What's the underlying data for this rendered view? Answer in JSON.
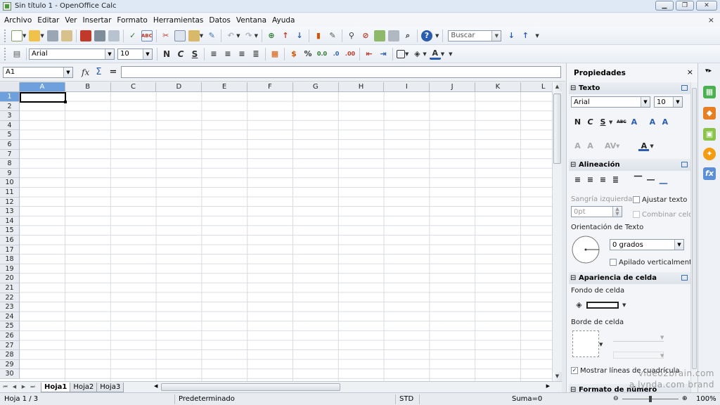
{
  "window": {
    "title": "Sin título 1 - OpenOffice Calc",
    "buttons": [
      "▁",
      "❐",
      "✕"
    ]
  },
  "menu": {
    "items": [
      "Archivo",
      "Editar",
      "Ver",
      "Insertar",
      "Formato",
      "Herramientas",
      "Datos",
      "Ventana",
      "Ayuda"
    ],
    "close_glyph": "×"
  },
  "toolbar1": {
    "find_placeholder": "Buscar"
  },
  "toolbar2": {
    "font_name": "Arial",
    "font_size": "10",
    "bold": "N",
    "italic": "C",
    "underline": "S",
    "percent": "%"
  },
  "formula_bar": {
    "name_box": "A1",
    "fx": "fx",
    "sum": "Σ",
    "equals": "=",
    "content": ""
  },
  "grid": {
    "columns": [
      "A",
      "B",
      "C",
      "D",
      "E",
      "F",
      "G",
      "H",
      "I",
      "J",
      "K",
      "L"
    ],
    "rows": [
      "1",
      "2",
      "3",
      "4",
      "5",
      "6",
      "7",
      "8",
      "9",
      "10",
      "11",
      "12",
      "13",
      "14",
      "15",
      "16",
      "17",
      "18",
      "19",
      "20",
      "21",
      "22",
      "23",
      "24",
      "25",
      "26",
      "27",
      "28",
      "29",
      "30"
    ],
    "selected_cell": "A1"
  },
  "sheets": {
    "tabs": [
      "Hoja1",
      "Hoja2",
      "Hoja3"
    ],
    "active": "Hoja1"
  },
  "status": {
    "page": "Hoja 1 / 3",
    "style": "Predeterminado",
    "mode": "STD",
    "sum": "Suma=0",
    "zoom": "100%"
  },
  "sidebar": {
    "title": "Propiedades",
    "close_glyph": "×",
    "text_section": {
      "title": "Texto",
      "font_name": "Arial",
      "font_size": "10",
      "bold": "N",
      "italic": "C",
      "underline": "S",
      "strike": "ABC"
    },
    "align_section": {
      "title": "Alineación",
      "indent_label": "Sangría izquierda:",
      "indent_value": "0pt",
      "wrap_label": "Ajustar texto",
      "merge_label": "Combinar celd",
      "orientation_label": "Orientación de Texto",
      "degrees_value": "0 grados",
      "stacked_label": "Apilado verticalmente"
    },
    "appearance_section": {
      "title": "Apariencia de celda",
      "background_label": "Fondo de celda",
      "border_label": "Borde de celda",
      "gridlines_label": "Mostrar líneas de cuadrícula"
    },
    "number_section": {
      "title": "Formato de número"
    }
  },
  "watermark": {
    "line1": "video2brain.com",
    "line2": "a lynda.com brand"
  },
  "colors": {
    "accent": "#6ea0de",
    "header_bg": "#e9edf2",
    "gridline": "#d8dce2"
  }
}
